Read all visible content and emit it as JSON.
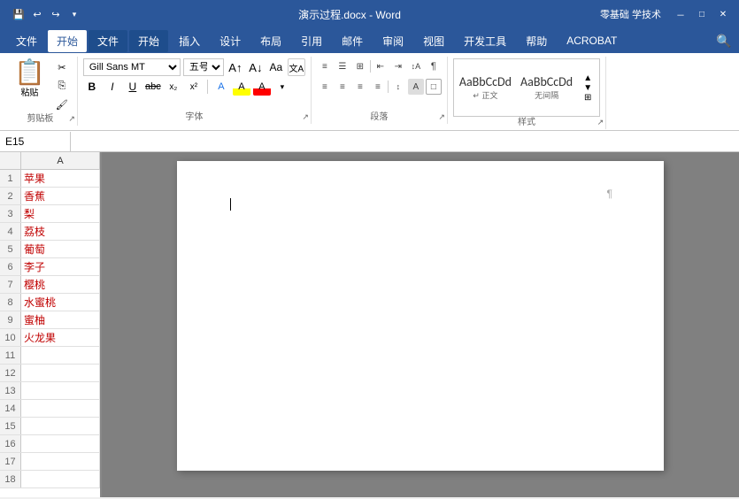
{
  "titlebar": {
    "title": "演示过程.docx - Word",
    "app": "零基础 学技术",
    "save_icon": "💾",
    "undo_icon": "↩",
    "redo_icon": "↪"
  },
  "menubar": {
    "items": [
      "文件",
      "开始",
      "文件",
      "开始",
      "插入",
      "设计",
      "布局",
      "引用",
      "邮件",
      "审阅",
      "视图",
      "开发工具",
      "帮助",
      "ACROBAT"
    ],
    "active": "开始"
  },
  "ribbon": {
    "clipboard": {
      "label": "剪贴板",
      "paste_label": "粘贴",
      "cut_label": "剪切",
      "copy_label": "复制",
      "format_painter_label": "格式刷"
    },
    "font": {
      "label": "字体",
      "font_name": "Gill Sans MT",
      "font_size": "五号",
      "bold": "B",
      "italic": "I",
      "underline": "U",
      "strikethrough": "abc",
      "subscript": "x₂",
      "superscript": "x²"
    },
    "paragraph": {
      "label": "段落"
    },
    "styles": {
      "label": "样式",
      "items": [
        {
          "name": "正文",
          "preview": "AaBbCcDd"
        },
        {
          "name": "无间隔",
          "preview": "AaBbCcDd"
        }
      ]
    }
  },
  "formula_bar": {
    "cell_ref": "E15"
  },
  "excel": {
    "col_header": "A",
    "rows": [
      {
        "num": "1",
        "value": "苹果"
      },
      {
        "num": "2",
        "value": "香蕉"
      },
      {
        "num": "3",
        "value": "梨"
      },
      {
        "num": "4",
        "value": "荔枝"
      },
      {
        "num": "5",
        "value": "葡萄"
      },
      {
        "num": "6",
        "value": "李子"
      },
      {
        "num": "7",
        "value": "樱桃"
      },
      {
        "num": "8",
        "value": "水蜜桃"
      },
      {
        "num": "9",
        "value": "蜜柚"
      },
      {
        "num": "10",
        "value": "火龙果"
      },
      {
        "num": "11",
        "value": ""
      },
      {
        "num": "12",
        "value": ""
      },
      {
        "num": "13",
        "value": ""
      },
      {
        "num": "14",
        "value": ""
      },
      {
        "num": "15",
        "value": ""
      },
      {
        "num": "16",
        "value": ""
      },
      {
        "num": "17",
        "value": ""
      },
      {
        "num": "18",
        "value": ""
      }
    ]
  },
  "word": {
    "content": ""
  }
}
